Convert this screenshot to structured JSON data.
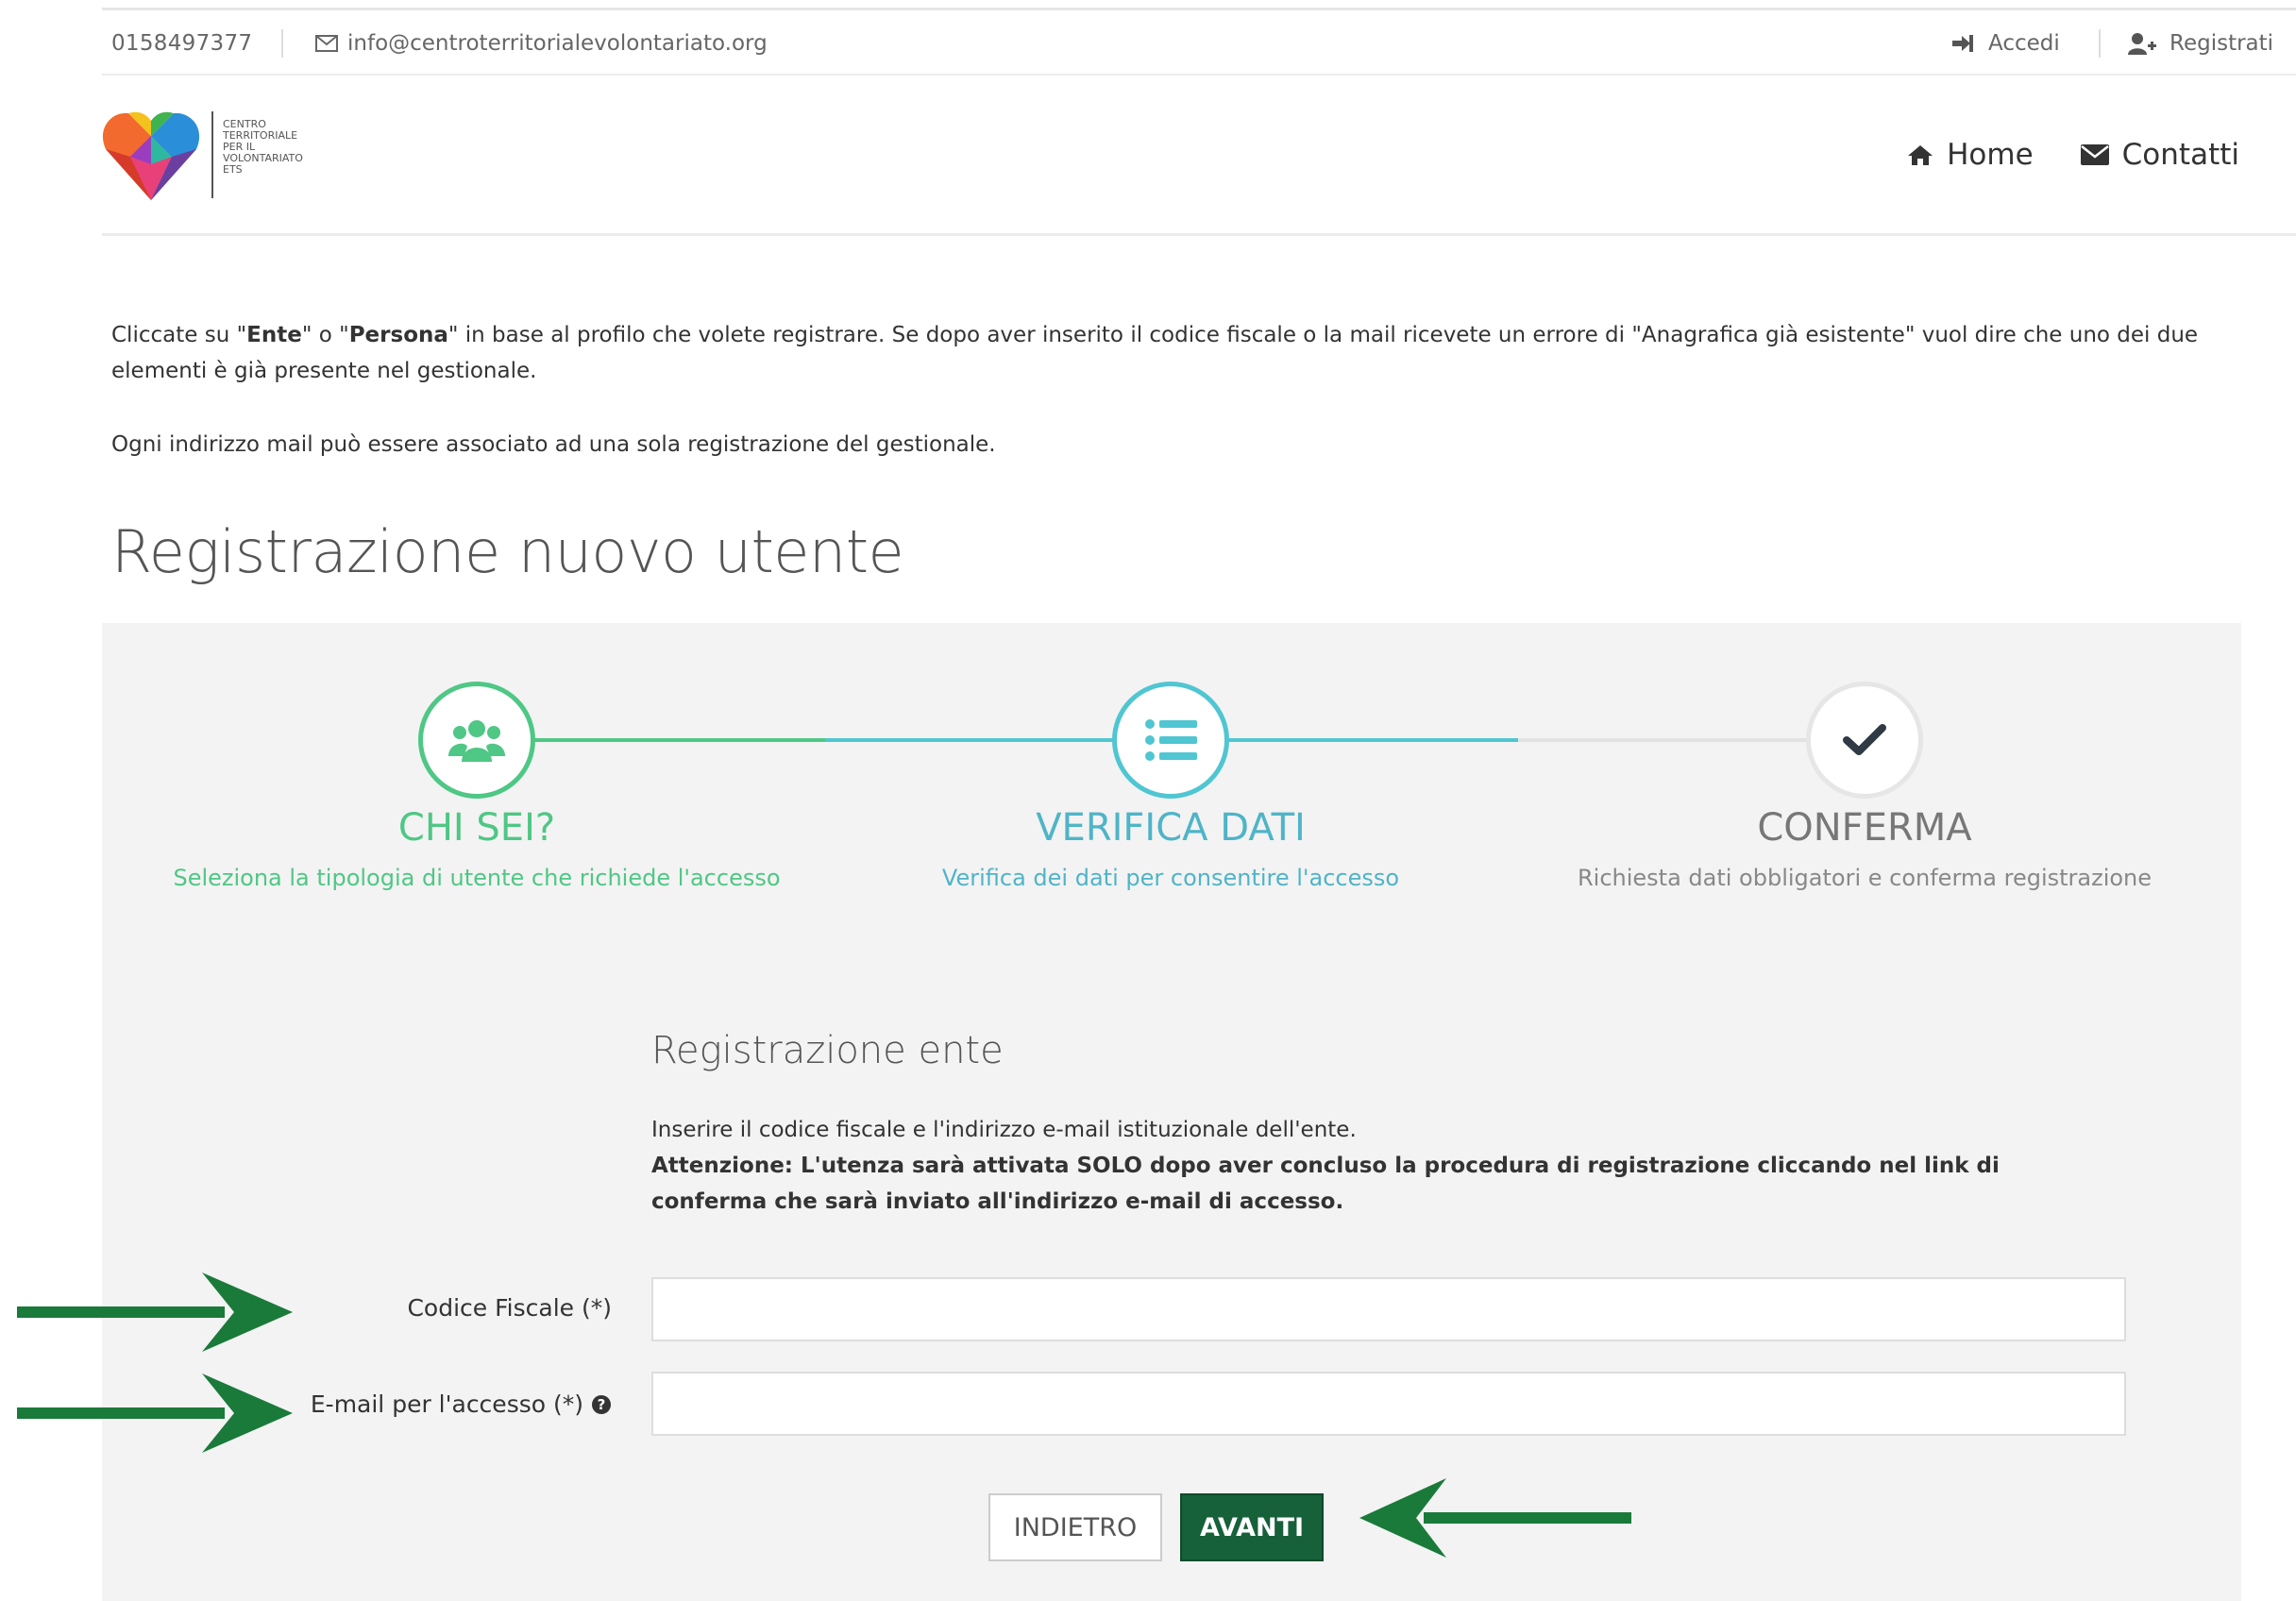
{
  "topbar": {
    "phone": "0158497377",
    "email": "info@centroterritorialevolontariato.org",
    "login": "Accedi",
    "register": "Registrati"
  },
  "logo": {
    "org_name": "CENTRO TERRITORIALE PER IL VOLONTARIATO ETS"
  },
  "nav": {
    "home": "Home",
    "contacts": "Contatti"
  },
  "intro": {
    "p1_a": "Cliccate su \"",
    "p1_b": "Ente",
    "p1_c": "\" o \"",
    "p1_d": "Persona",
    "p1_e": "\" in base al profilo che volete registrare. Se dopo aver inserito il codice fiscale o la mail ricevete un errore di \"Anagrafica già esistente\" vuol dire che uno dei due elementi è già presente nel gestionale.",
    "p2": "Ogni indirizzo mail può essere associato ad una sola registrazione del gestionale."
  },
  "page_title": "Registrazione nuovo utente",
  "steps": [
    {
      "title": "CHI SEI?",
      "subtitle": "Seleziona la tipologia di utente che richiede l'accesso",
      "status": "done"
    },
    {
      "title": "VERIFICA DATI",
      "subtitle": "Verifica dei dati per consentire l'accesso",
      "status": "active"
    },
    {
      "title": "CONFERMA",
      "subtitle": "Richiesta dati obbligatori e conferma registrazione",
      "status": "pending"
    }
  ],
  "form": {
    "title": "Registrazione ente",
    "desc1": "Inserire il codice fiscale e l'indirizzo e-mail istituzionale dell'ente.",
    "desc2": "Attenzione: L'utenza sarà attivata SOLO dopo aver concluso la procedura di registrazione cliccando nel link di conferma che sarà inviato all'indirizzo e-mail di accesso.",
    "fiscal_code_label": "Codice Fiscale (*)",
    "fiscal_code_value": "",
    "email_label": "E-mail per l'accesso (*)",
    "email_value": "",
    "back_button": "INDIETRO",
    "next_button": "AVANTI"
  },
  "colors": {
    "green": "#4fc785",
    "blue": "#4fc6d1",
    "button_green": "#17613a",
    "arrow_green": "#1a7a3a"
  },
  "icons": [
    "phone",
    "envelope-icon",
    "sign-in-icon",
    "user-plus-icon",
    "home-icon",
    "envelope-icon",
    "users-icon",
    "list-icon",
    "check-icon",
    "question-circle-icon",
    "arrow-right-icon",
    "arrow-left-icon"
  ]
}
